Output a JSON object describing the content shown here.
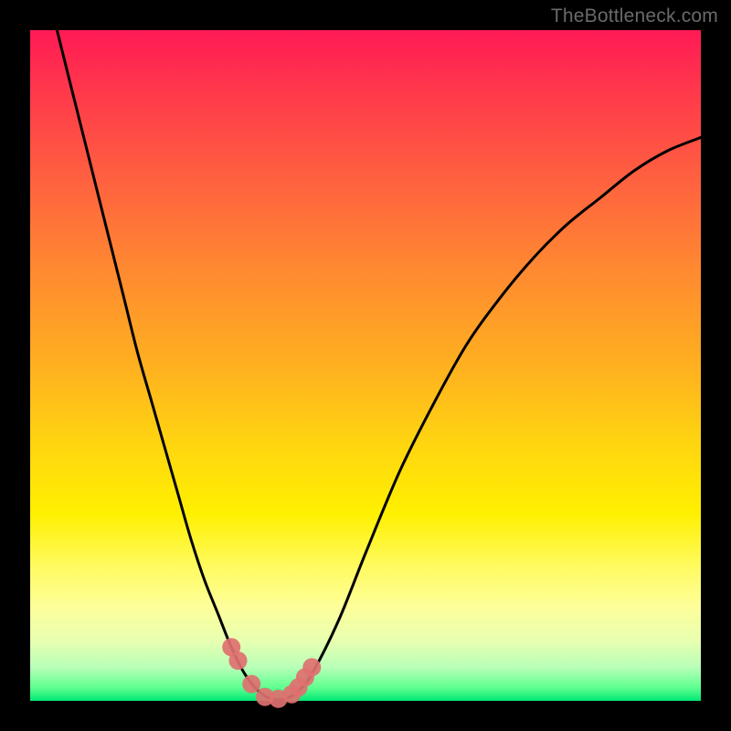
{
  "watermark": "TheBottleneck.com",
  "colors": {
    "frame": "#000000",
    "curve": "#000000",
    "marker": "#e07070",
    "gradient_top": "#ff1a55",
    "gradient_bottom": "#00e874"
  },
  "chart_data": {
    "type": "line",
    "title": "",
    "xlabel": "",
    "ylabel": "",
    "xlim": [
      0,
      100
    ],
    "ylim": [
      0,
      100
    ],
    "series": [
      {
        "name": "bottleneck-curve",
        "x": [
          4,
          6,
          8,
          10,
          12,
          14,
          16,
          18,
          20,
          22,
          24,
          26,
          28,
          30,
          32,
          34,
          36,
          38,
          40,
          42,
          46,
          50,
          55,
          60,
          65,
          70,
          75,
          80,
          85,
          90,
          95,
          100
        ],
        "y": [
          100,
          92,
          84,
          76,
          68,
          60,
          52,
          45,
          38,
          31,
          24,
          18,
          13,
          8,
          4,
          1.5,
          0.3,
          0.3,
          1.5,
          4,
          12,
          22,
          34,
          44,
          53,
          60,
          66,
          71,
          75,
          79,
          82,
          84
        ]
      }
    ],
    "markers": {
      "name": "highlighted-points",
      "x": [
        30,
        31,
        33,
        35,
        37,
        39,
        40,
        41,
        42
      ],
      "y": [
        8,
        6,
        2.5,
        0.6,
        0.3,
        1,
        2,
        3.5,
        5
      ]
    }
  }
}
